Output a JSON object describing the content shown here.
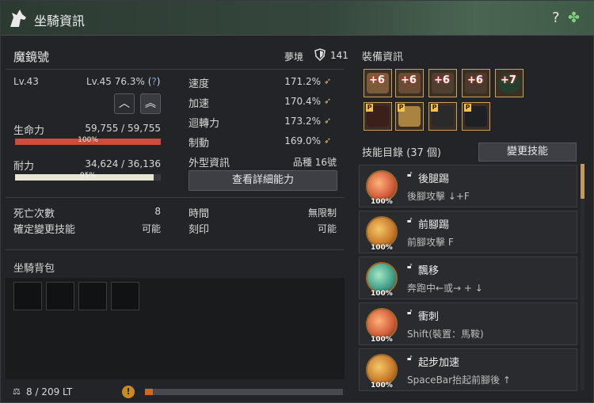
{
  "title": "坐騎資訊",
  "mount": {
    "name": "魔鏡號",
    "tier_label": "夢境",
    "tier_value": "141",
    "level": "Lv.43",
    "next_level": "Lv.45 76.3% (",
    "help_mark": "?",
    "help_close": ")"
  },
  "hp": {
    "label": "生命力",
    "value": "59,755 / 59,755",
    "percent_text": "100%",
    "fill": 1.0
  },
  "stamina": {
    "label": "耐力",
    "value": "34,624 / 36,136",
    "percent_text": "95%",
    "fill": 0.95
  },
  "stats": [
    {
      "label": "速度",
      "value": "171.2%"
    },
    {
      "label": "加速",
      "value": "170.4%"
    },
    {
      "label": "迴轉力",
      "value": "173.2%"
    },
    {
      "label": "制動",
      "value": "169.0%"
    },
    {
      "label": "外型資訊",
      "value": "品種 16號"
    }
  ],
  "detail_button": "查看詳細能力",
  "misc": [
    {
      "label": "死亡次數",
      "value": "8"
    },
    {
      "label": "確定變更技能",
      "value": "可能"
    },
    {
      "label": "時間",
      "value": "無限制"
    },
    {
      "label": "刻印",
      "value": "可能"
    }
  ],
  "bag": {
    "title": "坐騎背包",
    "weight": "8 / 209 LT",
    "weight_fill": 0.04
  },
  "equipment": {
    "title": "裝備資訊",
    "row1": [
      "+6",
      "+6",
      "+6",
      "+6",
      "+7"
    ],
    "row2_badge": "P"
  },
  "skills": {
    "title": "技能目錄 (37 個)",
    "change_button": "變更技能",
    "items": [
      {
        "name": "後腿踢",
        "command": "後腳攻擊 ↓+F",
        "percent": "100%"
      },
      {
        "name": "前腳踢",
        "command": "前腳攻擊 F",
        "percent": "100%"
      },
      {
        "name": "飄移",
        "command": "奔跑中←或→ + ↓",
        "percent": "100%"
      },
      {
        "name": "衝刺",
        "command": "Shift(裝置：馬鞍)",
        "percent": "100%"
      },
      {
        "name": "起步加速",
        "command": "SpaceBar抬起前腳後 ↑",
        "percent": "100%"
      }
    ]
  },
  "colors": {
    "hp_fill": "#cf4b3c",
    "stamina_fill": "#e9e4d4",
    "accent_gold": "#c7a35b"
  },
  "icons": {
    "help": "?",
    "clover": "✤"
  }
}
